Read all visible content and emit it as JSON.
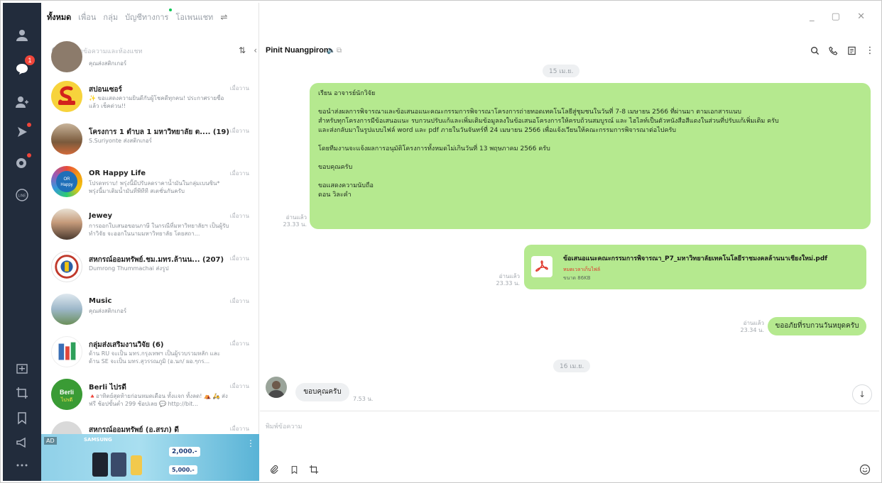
{
  "tabs": [
    {
      "label": "ทั้งหมด",
      "active": true
    },
    {
      "label": "เพื่อน",
      "active": false
    },
    {
      "label": "กลุ่ม",
      "active": false
    },
    {
      "label": "บัญชีทางการ",
      "active": false,
      "dot": true
    },
    {
      "label": "โอเพนแชท",
      "active": false
    }
  ],
  "search": {
    "placeholder": "ค้นหาข้อความและห้องแชท"
  },
  "rail": {
    "chat_badge": "1"
  },
  "chats": [
    {
      "name": "",
      "preview": "คุณส่งสติกเกอร์",
      "time": ""
    },
    {
      "name": "สปอนเซอร์",
      "preview": "✨ ขอแสดงความยินดีกับผู้โชคดีทุกคน! ประกาศรายชื่อแล้ว เช็คด่วน!!",
      "time": "เมื่อวาน"
    },
    {
      "name": "โครงการ 1 ตำบล 1 มหาวิทยาลัย ต.... (19)",
      "preview": "S.Suriyonte ส่งสติกเกอร์",
      "time": "เมื่อวาน"
    },
    {
      "name": "OR Happy Life",
      "preview": "โปรดทราบ! พรุ่งนี้มีปรับลดราคาน้ำมันในกลุ่มเบนซิน* พรุ่งนี้มาเติมน้ำมันที่พีทีที สเตชั่นกันครับ",
      "time": "เมื่อวาน"
    },
    {
      "name": "Jewey",
      "preview": "การออกใบเสนอขอนภาษี ในกรณีที่มหาวิทยาลัยฯ เป็นผู้รับทำวิจัย จะออกในนามมหาวิทยาลัย โดยสถา...",
      "time": "เมื่อวาน"
    },
    {
      "name": "สหกรณ์ออมทรัพย์.ชม.มทร.ล้านน... (207)",
      "preview": "Dumrong Thummachai ส่งรูป",
      "time": "เมื่อวาน"
    },
    {
      "name": "Music",
      "preview": "คุณส่งสติกเกอร์",
      "time": "เมื่อวาน"
    },
    {
      "name": "กลุ่มส่งเสริมงานวิจัย (6)",
      "preview": "ด้าน RU จะเป็น มทร.กรุงเทพฯ เป็นผู้รวบรวมหลัก และด้าน SE จะเป็น มทร.สุวรรณภูมิ (อ.นก/ ผอ.ๆกร...",
      "time": "เมื่อวาน"
    },
    {
      "name": "Berli ไปรดี",
      "preview": "🔺อาทิตย์สุดท้ายก่อนหมดเดือน ทั้งแจก ทั้งลด! ⛺ 🛵 ส่งฟรี ช้อปขั้นต่ำ 299 ช้อปเลย 💬 http://bit...",
      "time": "เมื่อวาน"
    },
    {
      "name": "สหกรณ์ออมทรัพย์ (อ.สรภ) ดี",
      "preview": "",
      "time": "เมื่อวาน"
    }
  ],
  "ad": {
    "tag": "AD",
    "brand": "SAMSUNG",
    "price1": "2,000.-",
    "price2": "5,000.-"
  },
  "conversation": {
    "title": "Pinit Nuangpirom",
    "date1": "15 เม.ย.",
    "date2": "16 เม.ย.",
    "message_lines": [
      "เรียน อาจารย์นักวิจัย",
      "ขอนำส่งผลการพิจารณาและข้อเสนอแนะคณะกรรมการพิจารณาโครงการถ่ายทอดเทคโนโลยีสู่ชุมชนในวันที่ 7-8 เมษายน 2566 ที่ผ่านมา ตามเอกสารแนบ",
      "สำหรับทุกโครงการมีข้อเสนอแนะ รบกวนปรับแก้และเพิ่มเติมข้อมูลลงในข้อเสนอโครงการให้ครบถ้วนสมบูรณ์ และ ไฮไลท์เป็นตัวหนังสือสีแดงในส่วนที่ปรับแก้เพิ่มเติม ครับ",
      "และส่งกลับมาในรูปแบบไฟล์ word และ pdf ภายในวันจันทร์ที่ 24 เมษายน 2566 เพื่อแจ้งเวียนให้คณะกรรมการพิจารณาต่อไปครับ",
      "โดยทีมงานจะแจ้งผลการอนุมัติโครงการทั้งหมดไม่เกินวันที่ 13 พฤษภาคม 2566 ครับ",
      "ขอบคุณครับ",
      "ขอแสดงความนับถือ",
      "ดอน วิละคำ"
    ],
    "message_read": "อ่านแล้ว",
    "message_time": "23.33 น.",
    "file": {
      "name": "ข้อเสนอแนะคณะกรรมการพิจารณา_P7_มหาวิทยาลัยเทคโนโลยีราชมงคลล้านนาเชียงใหม่.pdf",
      "expired": "หมดเวลาเก็บไฟล์",
      "size": "ขนาด 86KB",
      "read": "อ่านแล้ว",
      "time": "23.33 น."
    },
    "short_message": "ขออภัยที่รบกวนวันหยุดครับ",
    "short_read": "อ่านแล้ว",
    "short_time": "23.34 น.",
    "incoming_message": "ขอบคุณครับ",
    "incoming_time": "7.53 น."
  },
  "composer": {
    "placeholder": "พิมพ์ข้อความ"
  },
  "colors": {
    "rail": "#222c3c",
    "bubble_out": "#b5e98f",
    "bubble_in": "#eef0f2",
    "line_green": "#06c755",
    "badge": "#f0453a"
  }
}
